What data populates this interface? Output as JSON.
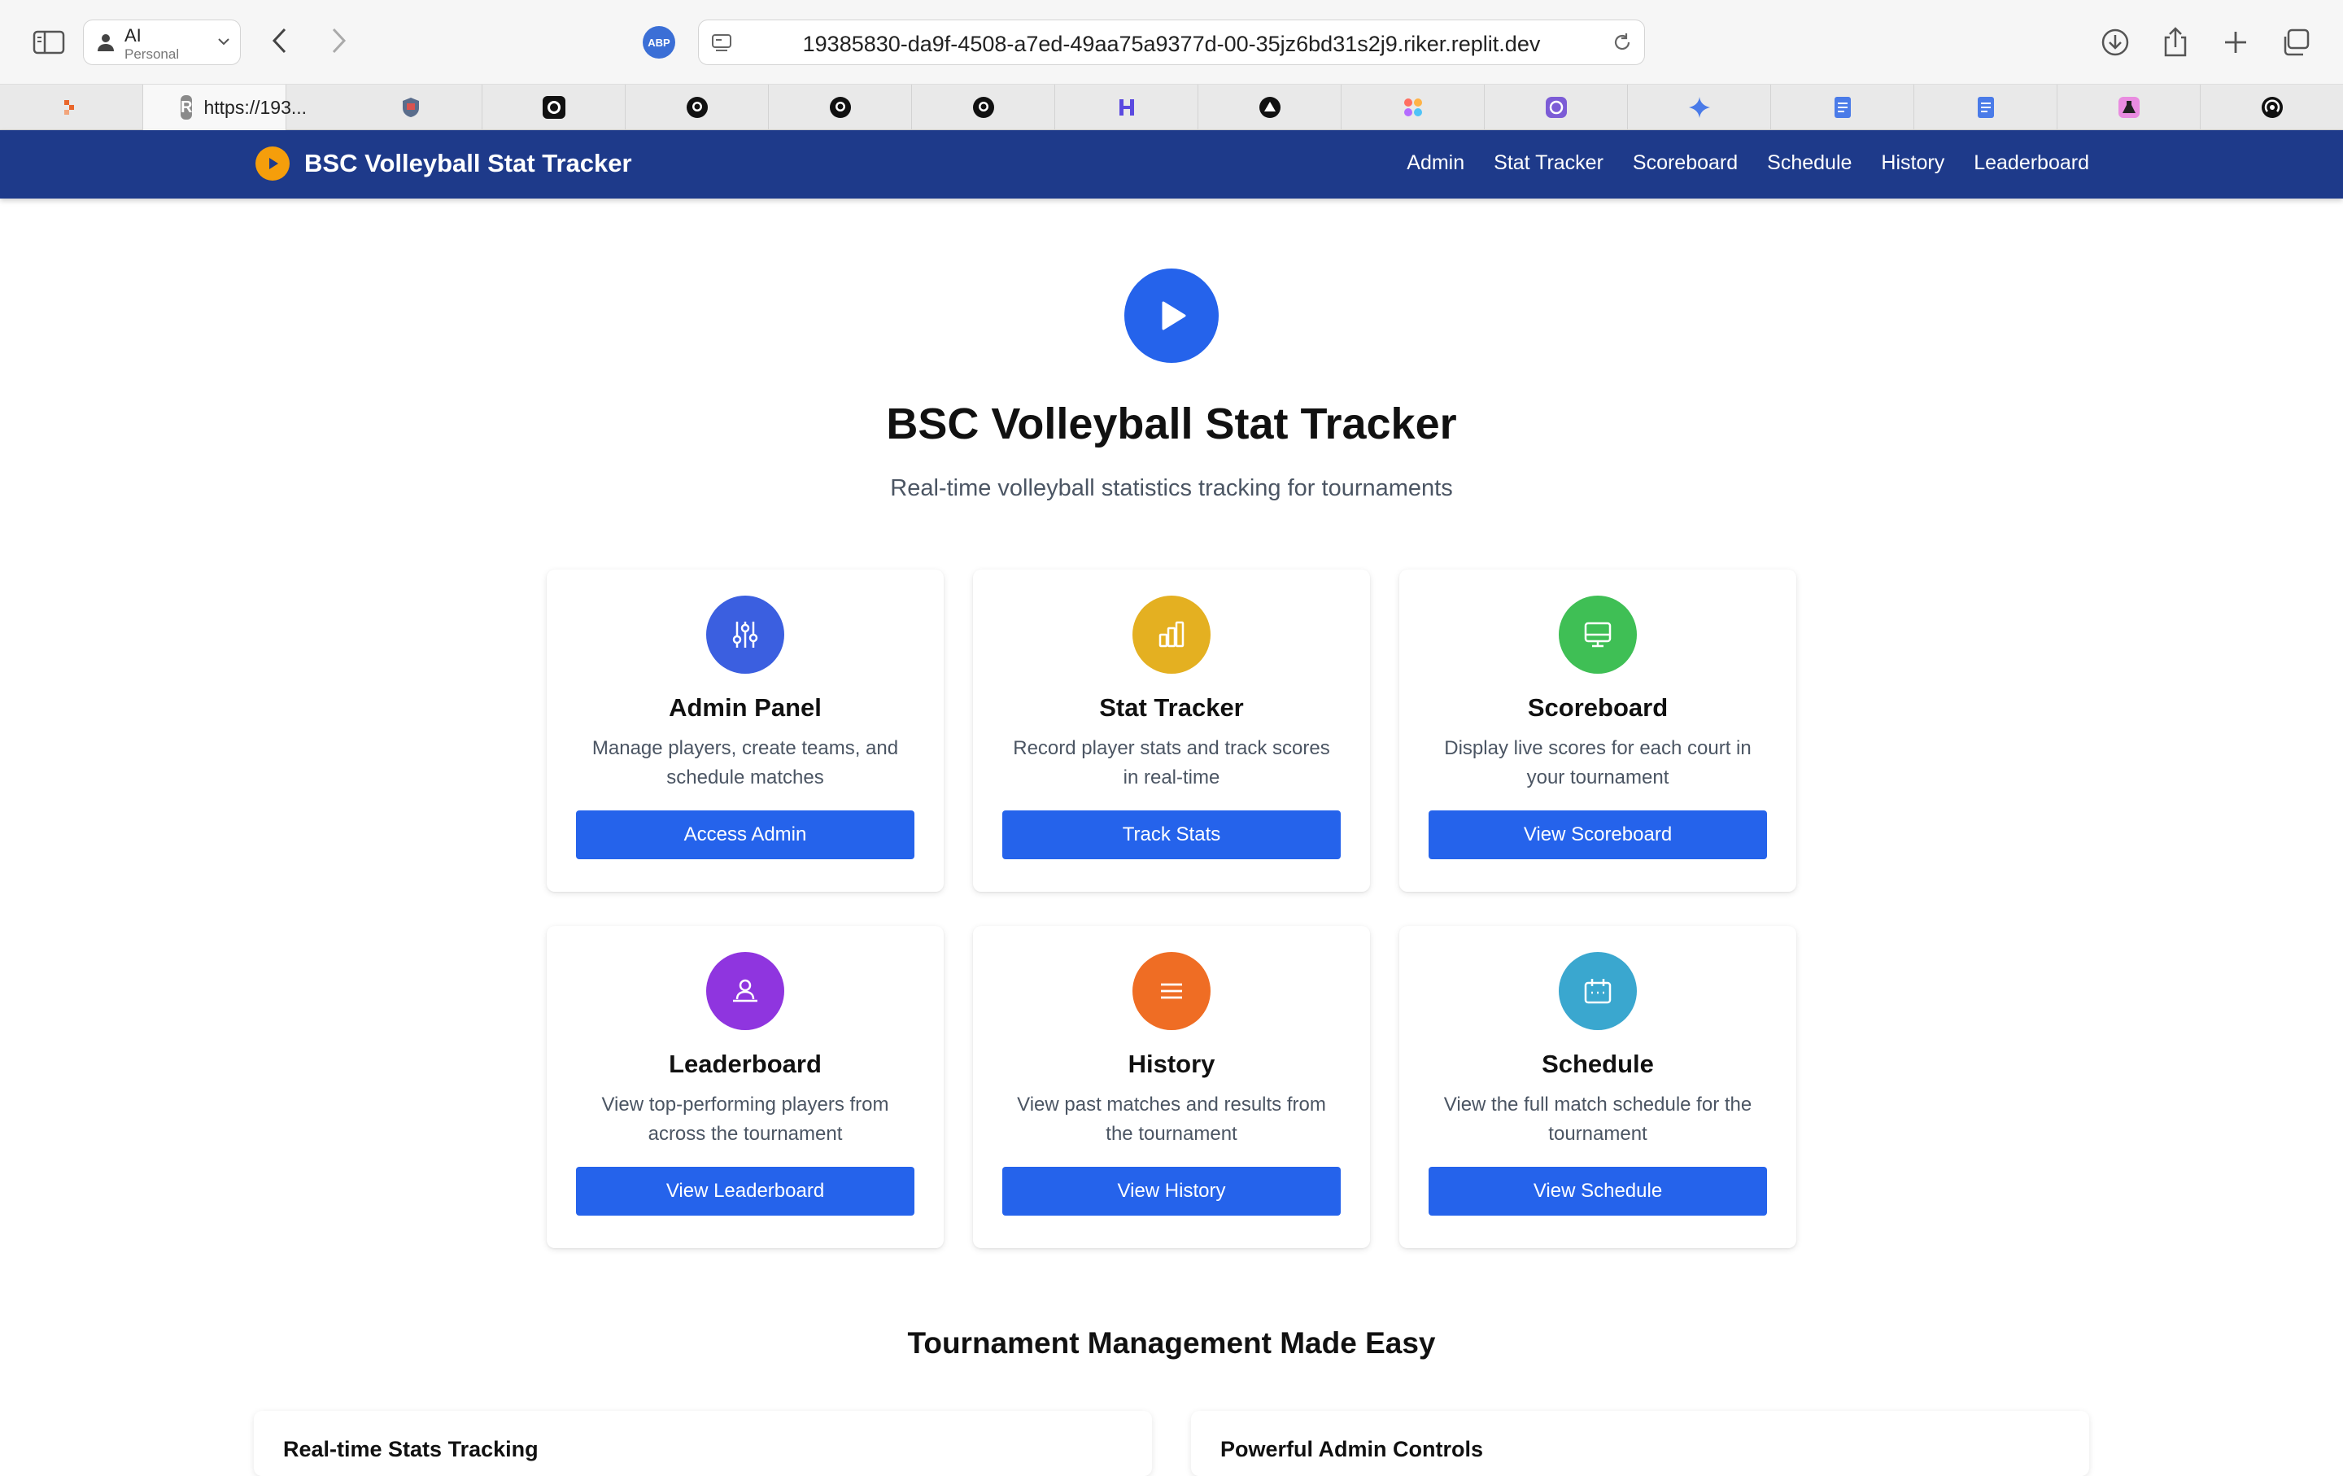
{
  "browser": {
    "profile": {
      "name": "AI",
      "subtitle": "Personal"
    },
    "url": "19385830-da9f-4508-a7ed-49aa75a9377d-00-35jz6bd31s2j9.riker.replit.dev",
    "abp_label": "ABP",
    "active_tab": {
      "title": "https://193...",
      "favicon_letter": "R"
    }
  },
  "app": {
    "brand": "BSC Volleyball Stat Tracker",
    "nav": [
      "Admin",
      "Stat Tracker",
      "Scoreboard",
      "Schedule",
      "History",
      "Leaderboard"
    ]
  },
  "hero": {
    "title": "BSC Volleyball Stat Tracker",
    "subtitle": "Real-time volleyball statistics tracking for tournaments"
  },
  "cards": [
    {
      "icon": "sliders-icon",
      "color": "#3b5fe0",
      "title": "Admin Panel",
      "desc": "Manage players, create teams, and schedule matches",
      "button": "Access Admin"
    },
    {
      "icon": "bar-chart-icon",
      "color": "#e4b021",
      "title": "Stat Tracker",
      "desc": "Record player stats and track scores in real-time",
      "button": "Track Stats"
    },
    {
      "icon": "monitor-icon",
      "color": "#3fbf55",
      "title": "Scoreboard",
      "desc": "Display live scores for each court in your tournament",
      "button": "View Scoreboard"
    },
    {
      "icon": "user-podium-icon",
      "color": "#8f35df",
      "title": "Leaderboard",
      "desc": "View top-performing players from across the tournament",
      "button": "View Leaderboard"
    },
    {
      "icon": "list-icon",
      "color": "#ef6d24",
      "title": "History",
      "desc": "View past matches and results from the tournament",
      "button": "View History"
    },
    {
      "icon": "calendar-icon",
      "color": "#3aa7cf",
      "title": "Schedule",
      "desc": "View the full match schedule for the tournament",
      "button": "View Schedule"
    }
  ],
  "features": {
    "title": "Tournament Management Made Easy",
    "items": [
      {
        "title": "Real-time Stats Tracking"
      },
      {
        "title": "Powerful Admin Controls"
      }
    ]
  }
}
